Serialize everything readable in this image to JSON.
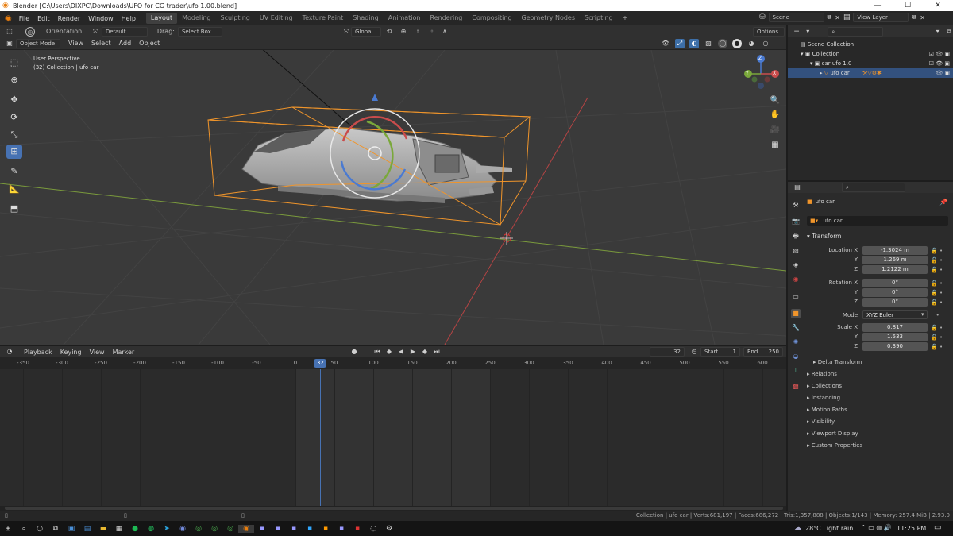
{
  "window": {
    "title": "Blender [C:\\Users\\DIXPC\\Downloads\\UFO for CG trader\\ufo 1.00.blend]"
  },
  "menu": [
    "File",
    "Edit",
    "Render",
    "Window",
    "Help"
  ],
  "workspaces": [
    "Layout",
    "Modeling",
    "Sculpting",
    "UV Editing",
    "Texture Paint",
    "Shading",
    "Animation",
    "Rendering",
    "Compositing",
    "Geometry Nodes",
    "Scripting"
  ],
  "scene": {
    "name": "Scene",
    "view_layer": "View Layer"
  },
  "toolheader": {
    "orientation_label": "Orientation:",
    "orientation_value": "Default",
    "drag_label": "Drag:",
    "drag_value": "Select Box",
    "transform_orientation": "Global",
    "options": "Options"
  },
  "viewheader": {
    "mode": "Object Mode",
    "menus": [
      "View",
      "Select",
      "Add",
      "Object"
    ]
  },
  "viewport": {
    "line1": "User Perspective",
    "line2": "(32) Collection | ufo car"
  },
  "gizmo": {
    "x": "X",
    "y": "Y",
    "z": "Z"
  },
  "outliner": {
    "scene_collection": "Scene Collection",
    "collection": "Collection",
    "parent": "car ufo 1.0",
    "child": "ufo car"
  },
  "properties": {
    "object_name": "ufo car",
    "data_name": "ufo car",
    "transform_title": "Transform",
    "location": {
      "label": "Location X",
      "x": "-1.3024 m",
      "y": "1.269 m",
      "z": "1.2122 m"
    },
    "rotation": {
      "label": "Rotation X",
      "x": "0°",
      "y": "0°",
      "z": "0°"
    },
    "mode_label": "Mode",
    "mode_value": "XYZ Euler",
    "scale": {
      "label": "Scale X",
      "x": "0.817",
      "y": "1.533",
      "z": "0.390"
    },
    "axis_y": "Y",
    "axis_z": "Z",
    "delta": "Delta Transform",
    "panels": [
      "Relations",
      "Collections",
      "Instancing",
      "Motion Paths",
      "Visibility",
      "Viewport Display",
      "Custom Properties"
    ]
  },
  "timeline": {
    "menus": [
      "Playback",
      "Keying",
      "View",
      "Marker"
    ],
    "current_frame": "32",
    "start_label": "Start",
    "start": "1",
    "end_label": "End",
    "end": "250",
    "ticks": [
      "-350",
      "-300",
      "-250",
      "-200",
      "-150",
      "-100",
      "-50",
      "0",
      "50",
      "100",
      "150",
      "200",
      "250",
      "300",
      "350",
      "400",
      "450",
      "500",
      "550",
      "600"
    ],
    "playhead": "32"
  },
  "status": "Collection | ufo car | Verts:681,197 | Faces:686,272 | Tris:1,357,888 | Objects:1/143 | Memory: 257.4 MiB | 2.93.0",
  "taskbar": {
    "weather": "28°C  Light rain",
    "time": "11:25 PM"
  },
  "colors": {
    "accent": "#4772b3",
    "selection": "#f0952b",
    "x_axis": "#c94c4c",
    "y_axis": "#7aa83a",
    "z_axis": "#4a7ad1"
  }
}
